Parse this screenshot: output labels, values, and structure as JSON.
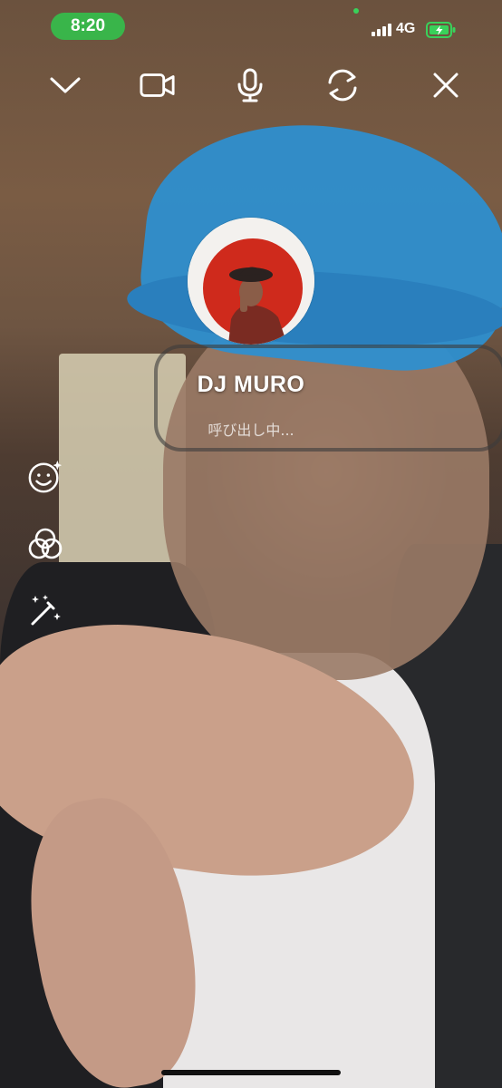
{
  "status_bar": {
    "time": "8:20",
    "network": "4G",
    "signal_icon": "signal-bars-icon",
    "battery_icon": "battery-charging-icon",
    "colors": {
      "time_pill": "#39b54a",
      "battery": "#39d15a"
    }
  },
  "top_controls": [
    {
      "name": "minimize",
      "icon": "chevron-down-icon"
    },
    {
      "name": "camera-toggle",
      "icon": "video-camera-icon"
    },
    {
      "name": "mic-toggle",
      "icon": "microphone-icon"
    },
    {
      "name": "switch-camera",
      "icon": "camera-switch-icon"
    },
    {
      "name": "end-call",
      "icon": "close-icon"
    }
  ],
  "call": {
    "caller_name": "DJ MURO",
    "status": "呼び出し中..."
  },
  "side_tools": [
    {
      "name": "face-effects",
      "icon": "face-sparkle-icon"
    },
    {
      "name": "filters",
      "icon": "filter-circles-icon"
    },
    {
      "name": "beauty",
      "icon": "magic-wand-icon"
    }
  ]
}
